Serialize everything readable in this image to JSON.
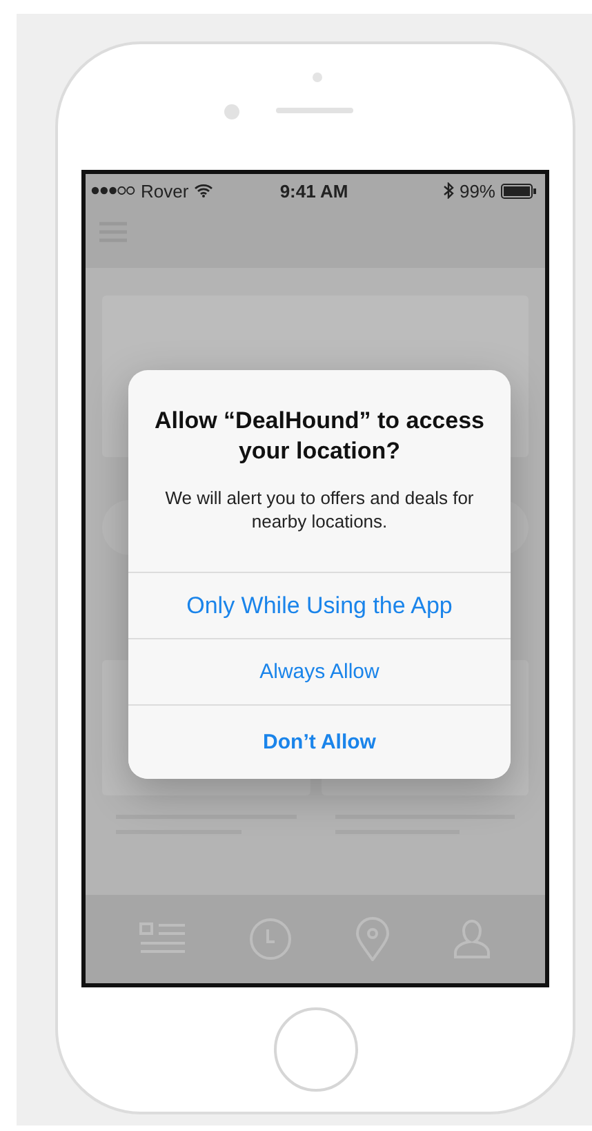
{
  "status_bar": {
    "carrier": "Rover",
    "time": "9:41 AM",
    "battery": "99%"
  },
  "alert": {
    "title": "Allow “DealHound”  to access your location?",
    "message": "We will alert you to offers and deals for nearby locations.",
    "buttons": [
      {
        "label": "Only While Using the App",
        "kind": "large"
      },
      {
        "label": "Always Allow",
        "kind": "normal"
      },
      {
        "label": "Don’t Allow",
        "kind": "bold"
      }
    ]
  }
}
